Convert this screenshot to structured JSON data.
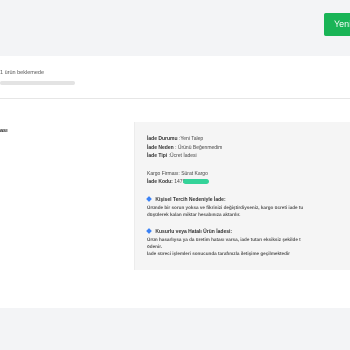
{
  "header": {
    "new_button_label": "Yeni"
  },
  "order_status": {
    "text": "1 ürün beklemede",
    "progress": 0.0
  },
  "section": {
    "label": "ası"
  },
  "return_details": {
    "status_key": "İade Durumu",
    "status_value": "Yeni Talep",
    "reason_key": "İade Neden",
    "reason_value": "Ürünü Beğenmedim",
    "type_key": "İade Tipi",
    "type_value": "Ücret İadesi",
    "cargo_company_key": "Kargo Firması:",
    "cargo_company_value": "Sürat Kargo",
    "return_code_key": "İade Kodu:",
    "return_code_value": "1479",
    "highlight_color": "#34d399"
  },
  "notes": {
    "personal": {
      "title": "Kişisel Tercih Nedeniyle İade:",
      "line1": "Üründe bir sorun yoksa ve fikrinizi değiştirdiyseniz, kargo ücreti iade tu",
      "line2": "düşülerek kalan miktar hesabınıza aktarılır."
    },
    "defective": {
      "title": "Kusurlu veya Hatalı Ürün İadesi:",
      "line1": "Ürün hasarlıysa ya da üretim hatası varsa, iade tutarı eksiksiz şekilde t",
      "line2": "ödenir.",
      "line3": "İade süreci işlemleri sonucunda tarafınızla iletişime geçilmektedir"
    },
    "bullet_color": "#3b82f6"
  },
  "colors": {
    "accent": "#19b456",
    "page_bg": "#f3f4f6",
    "panel_bg": "#ffffff",
    "box_bg": "#f5f5f5"
  }
}
